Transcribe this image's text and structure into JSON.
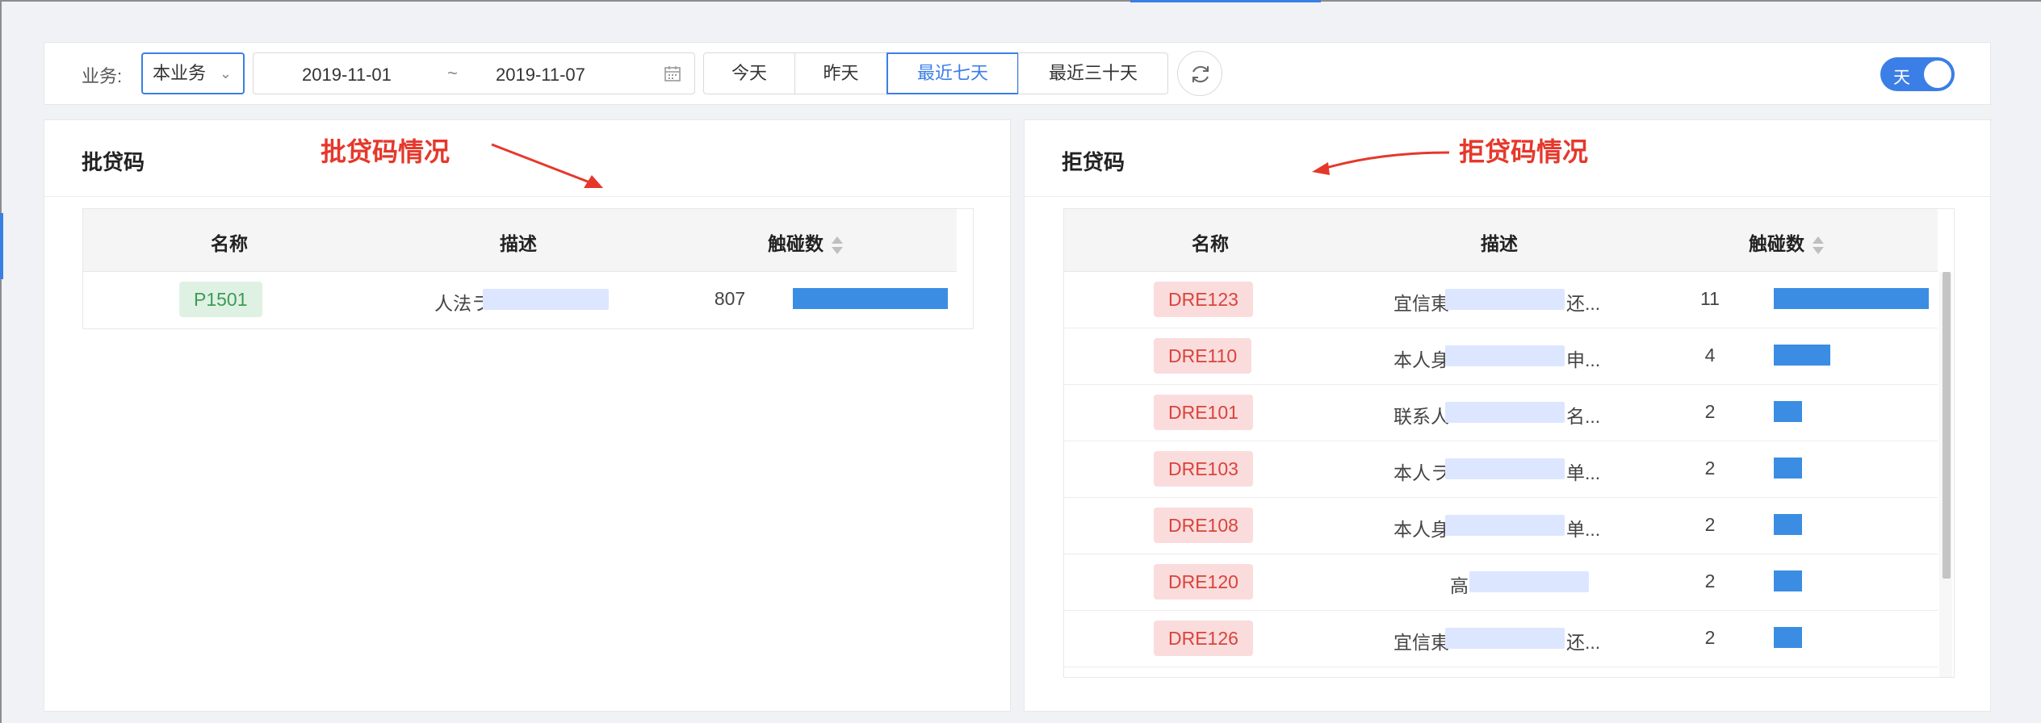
{
  "toolbar": {
    "business_label": "业务:",
    "business_value": "本业务",
    "date_start": "2019-11-01",
    "date_separator": "~",
    "date_end": "2019-11-07",
    "range_buttons": [
      "今天",
      "昨天",
      "最近七天",
      "最近三十天"
    ],
    "active_range": "最近七天",
    "toggle_label": "天",
    "accent_color": "#3b7fe6"
  },
  "left_panel": {
    "title": "批贷码",
    "annotation": "批贷码情况",
    "columns": [
      "名称",
      "描述",
      "触碰数"
    ],
    "rows": [
      {
        "code": "P1501",
        "desc": "人法ラ",
        "count": "807",
        "bar": 1.0
      }
    ]
  },
  "right_panel": {
    "title": "拒贷码",
    "annotation": "拒贷码情况",
    "columns": [
      "名称",
      "描述",
      "触碰数"
    ],
    "rows": [
      {
        "code": "DRE123",
        "desc_start": "宜信東",
        "desc_end": "还...",
        "count": "11",
        "bar": 1.0
      },
      {
        "code": "DRE110",
        "desc_start": "本人身",
        "desc_end": "申...",
        "count": "4",
        "bar": 0.364
      },
      {
        "code": "DRE101",
        "desc_start": "联系人",
        "desc_end": "名...",
        "count": "2",
        "bar": 0.182
      },
      {
        "code": "DRE103",
        "desc_start": "本人ラ",
        "desc_end": "单...",
        "count": "2",
        "bar": 0.182
      },
      {
        "code": "DRE108",
        "desc_start": "本人身",
        "desc_end": "单...",
        "count": "2",
        "bar": 0.182
      },
      {
        "code": "DRE120",
        "desc_start": "高",
        "desc_end": "",
        "count": "2",
        "bar": 0.182
      },
      {
        "code": "DRE126",
        "desc_start": "宜信東",
        "desc_end": "还...",
        "count": "2",
        "bar": 0.182
      }
    ]
  }
}
